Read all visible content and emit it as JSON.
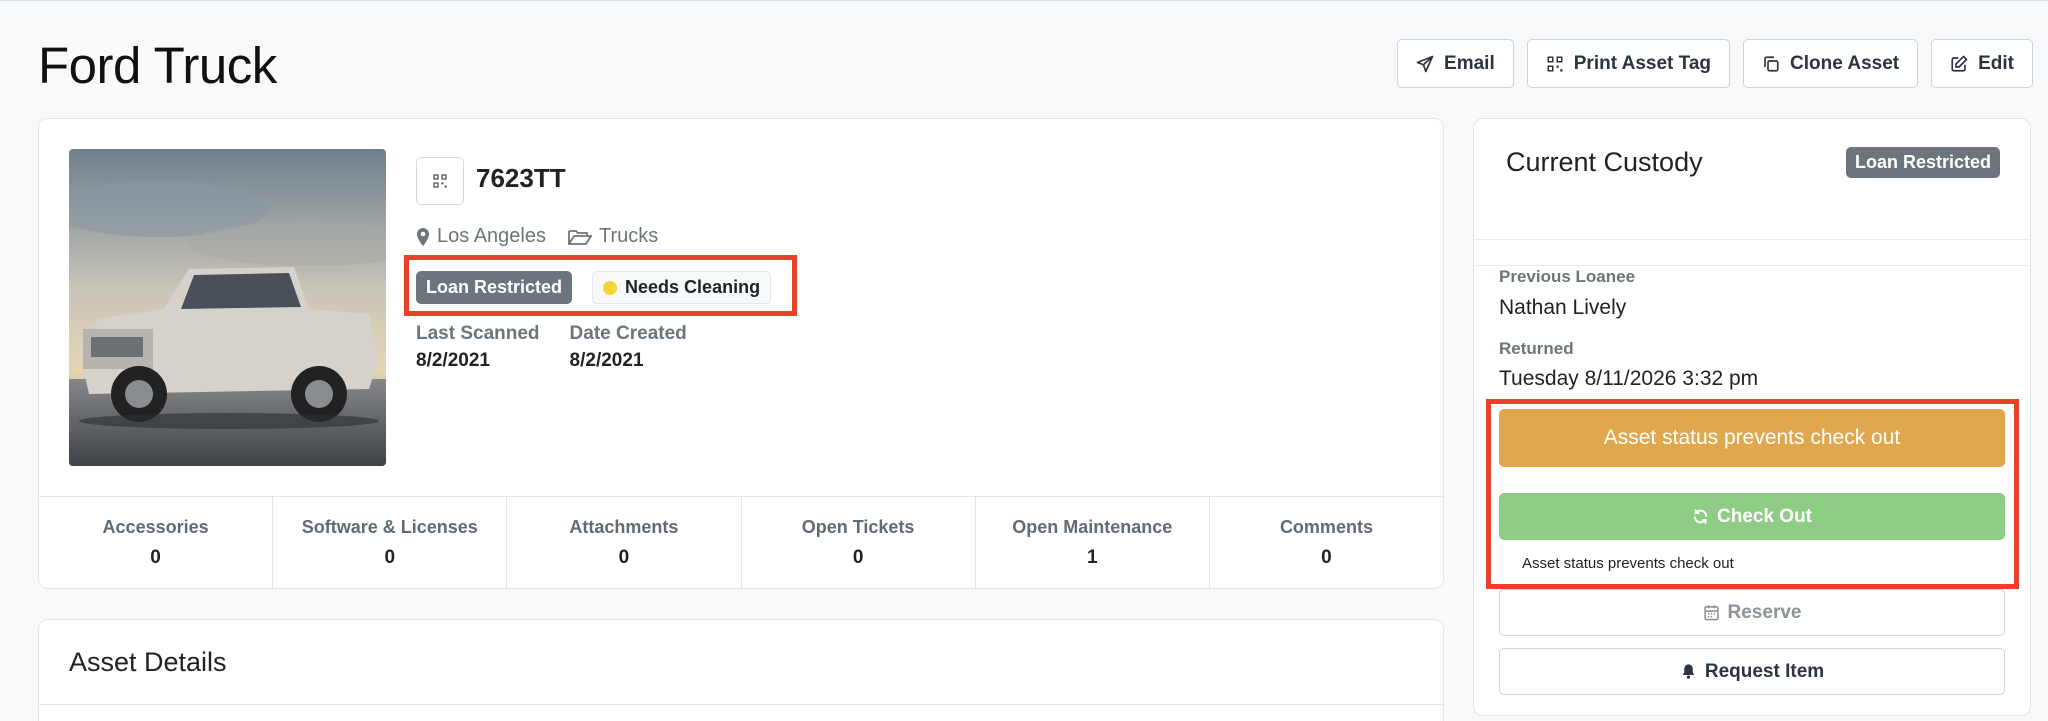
{
  "page": {
    "title": "Ford Truck"
  },
  "actions": {
    "email": "Email",
    "print": "Print Asset Tag",
    "clone": "Clone Asset",
    "edit": "Edit"
  },
  "asset": {
    "id": "7623TT",
    "location": "Los Angeles",
    "category": "Trucks",
    "badges": {
      "restricted": "Loan Restricted",
      "cleaning": "Needs Cleaning"
    },
    "last_scanned_label": "Last Scanned",
    "last_scanned": "8/2/2021",
    "date_created_label": "Date Created",
    "date_created": "8/2/2021"
  },
  "stats": [
    {
      "label": "Accessories",
      "value": "0"
    },
    {
      "label": "Software & Licenses",
      "value": "0"
    },
    {
      "label": "Attachments",
      "value": "0"
    },
    {
      "label": "Open Tickets",
      "value": "0"
    },
    {
      "label": "Open Maintenance",
      "value": "1"
    },
    {
      "label": "Comments",
      "value": "0"
    }
  ],
  "details": {
    "title": "Asset Details"
  },
  "custody": {
    "title": "Current Custody",
    "badge": "Loan Restricted",
    "previous_loanee_label": "Previous Loanee",
    "previous_loanee": "Nathan Lively",
    "returned_label": "Returned",
    "returned": "Tuesday 8/11/2026 3:32 pm",
    "status_button": "Asset status prevents check out",
    "checkout_button": "Check Out",
    "help_text": "Asset status prevents check out",
    "reserve_button": "Reserve",
    "request_button": "Request Item"
  },
  "colors": {
    "highlight": "#e8412c",
    "warning": "#e0a84e",
    "success": "#8fcd86",
    "secondary_badge": "#6c757d",
    "status_dot": "#f4d636"
  },
  "icons": [
    "paper-plane-icon",
    "qr-code-icon",
    "copy-icon",
    "edit-icon",
    "map-marker-icon",
    "folder-open-icon",
    "sync-icon",
    "calendar-icon",
    "bell-icon"
  ]
}
